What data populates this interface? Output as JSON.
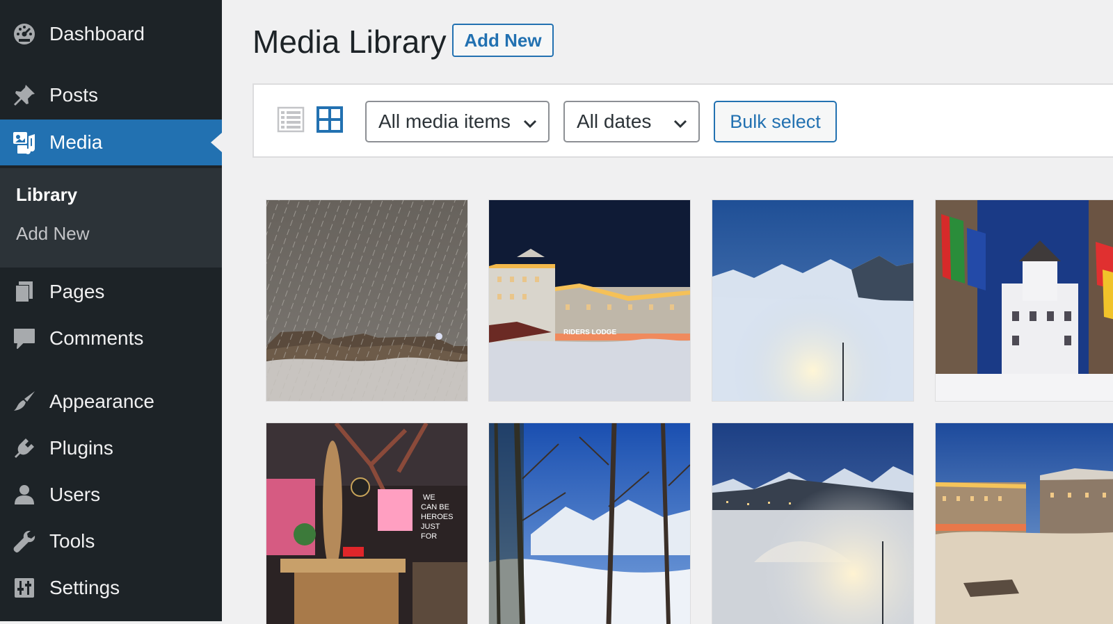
{
  "sidebar": {
    "items": [
      {
        "label": "Dashboard",
        "icon": "dashboard-icon"
      },
      {
        "label": "Posts",
        "icon": "pushpin-icon"
      },
      {
        "label": "Media",
        "icon": "media-icon",
        "current": true
      },
      {
        "label": "Pages",
        "icon": "pages-icon"
      },
      {
        "label": "Comments",
        "icon": "comment-icon"
      },
      {
        "label": "Appearance",
        "icon": "paintbrush-icon"
      },
      {
        "label": "Plugins",
        "icon": "plug-icon"
      },
      {
        "label": "Users",
        "icon": "user-icon"
      },
      {
        "label": "Tools",
        "icon": "wrench-icon"
      },
      {
        "label": "Settings",
        "icon": "settings-sliders-icon"
      }
    ],
    "submenu": [
      {
        "label": "Library",
        "current": true
      },
      {
        "label": "Add New"
      }
    ]
  },
  "header": {
    "title": "Media Library",
    "add_new_label": "Add New"
  },
  "toolbar": {
    "view_list_icon": "list-view-icon",
    "view_grid_icon": "grid-view-icon",
    "active_view": "grid",
    "media_type_filter": "All media items",
    "date_filter": "All dates",
    "bulk_select_label": "Bulk select"
  },
  "media_grid": [
    {
      "name": "snowfall-chalets-thumbnail"
    },
    {
      "name": "riders-lodge-night-thumbnail",
      "sign_text": "RIDERS LODGE"
    },
    {
      "name": "ski-slope-dusk-thumbnail"
    },
    {
      "name": "flags-tower-building-thumbnail"
    },
    {
      "name": "bar-interior-thumbnail",
      "sign_text": "WE CAN BE HEROES JUST FOR ONE DAY"
    },
    {
      "name": "forest-mountain-view-thumbnail"
    },
    {
      "name": "village-mountains-dusk-thumbnail"
    },
    {
      "name": "lodge-sunset-snow-thumbnail"
    }
  ],
  "colors": {
    "sidebar_bg": "#1d2327",
    "submenu_bg": "#2c3338",
    "accent": "#2271b1",
    "page_bg": "#f0f0f1"
  }
}
